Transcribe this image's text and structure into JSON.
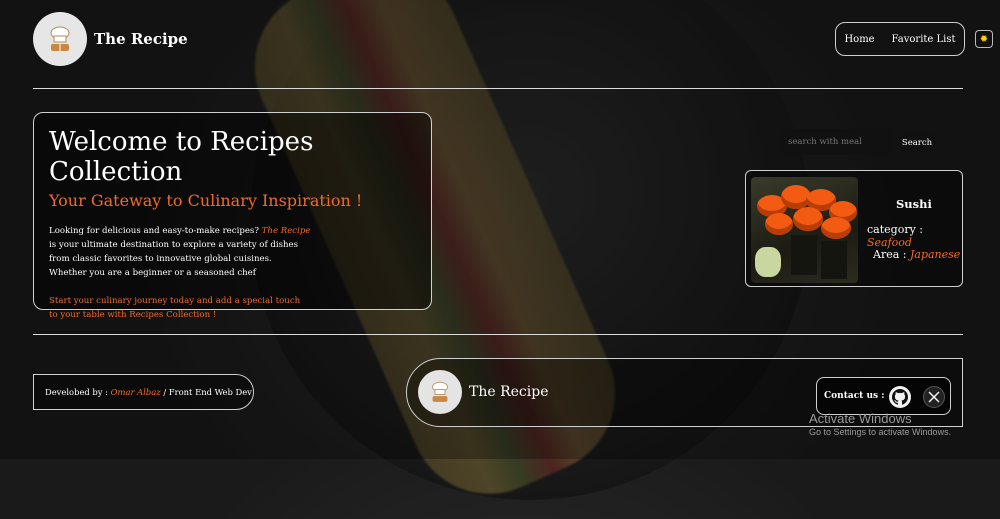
{
  "header": {
    "brand": "The Recipe",
    "nav": [
      "Home",
      "Favorite List"
    ],
    "theme_icon": "sun-icon"
  },
  "hero": {
    "title": "Welcome to Recipes Collection",
    "subtitle": "Your Gateway to Culinary Inspiration !",
    "intro_lines": [
      "Looking for delicious and easy-to-make recipes?",
      "is your ultimate destination to explore a variety of dishes",
      "from classic favorites to innovative global cuisines.",
      "Whether you are a beginner or a seasoned chef"
    ],
    "brand_highlight": "The Recipe",
    "cta_lines": [
      "Start your culinary journey today and add a special touch",
      "to your table with Recipes Collection !"
    ]
  },
  "search": {
    "placeholder": "search with meal",
    "button": "Search"
  },
  "meal_card": {
    "name": "Sushi",
    "category_label": "category :",
    "category": "Seafood",
    "area_label": "Area :",
    "area": "Japanese"
  },
  "footer": {
    "credit_prefix": "Develobed by :",
    "author": "Omar Albaz",
    "credit_suffix": "/ Front End Web Dev",
    "brand": "The Recipe",
    "contact_label": "Contact us :",
    "social": [
      "github-icon",
      "x-icon"
    ]
  },
  "os_overlay": {
    "line1": "Activate Windows",
    "line2": "Go to Settings to activate Windows."
  },
  "colors": {
    "accent": "#f26a2a",
    "border": "#d0d0d0",
    "background": "#1b1b1b"
  }
}
